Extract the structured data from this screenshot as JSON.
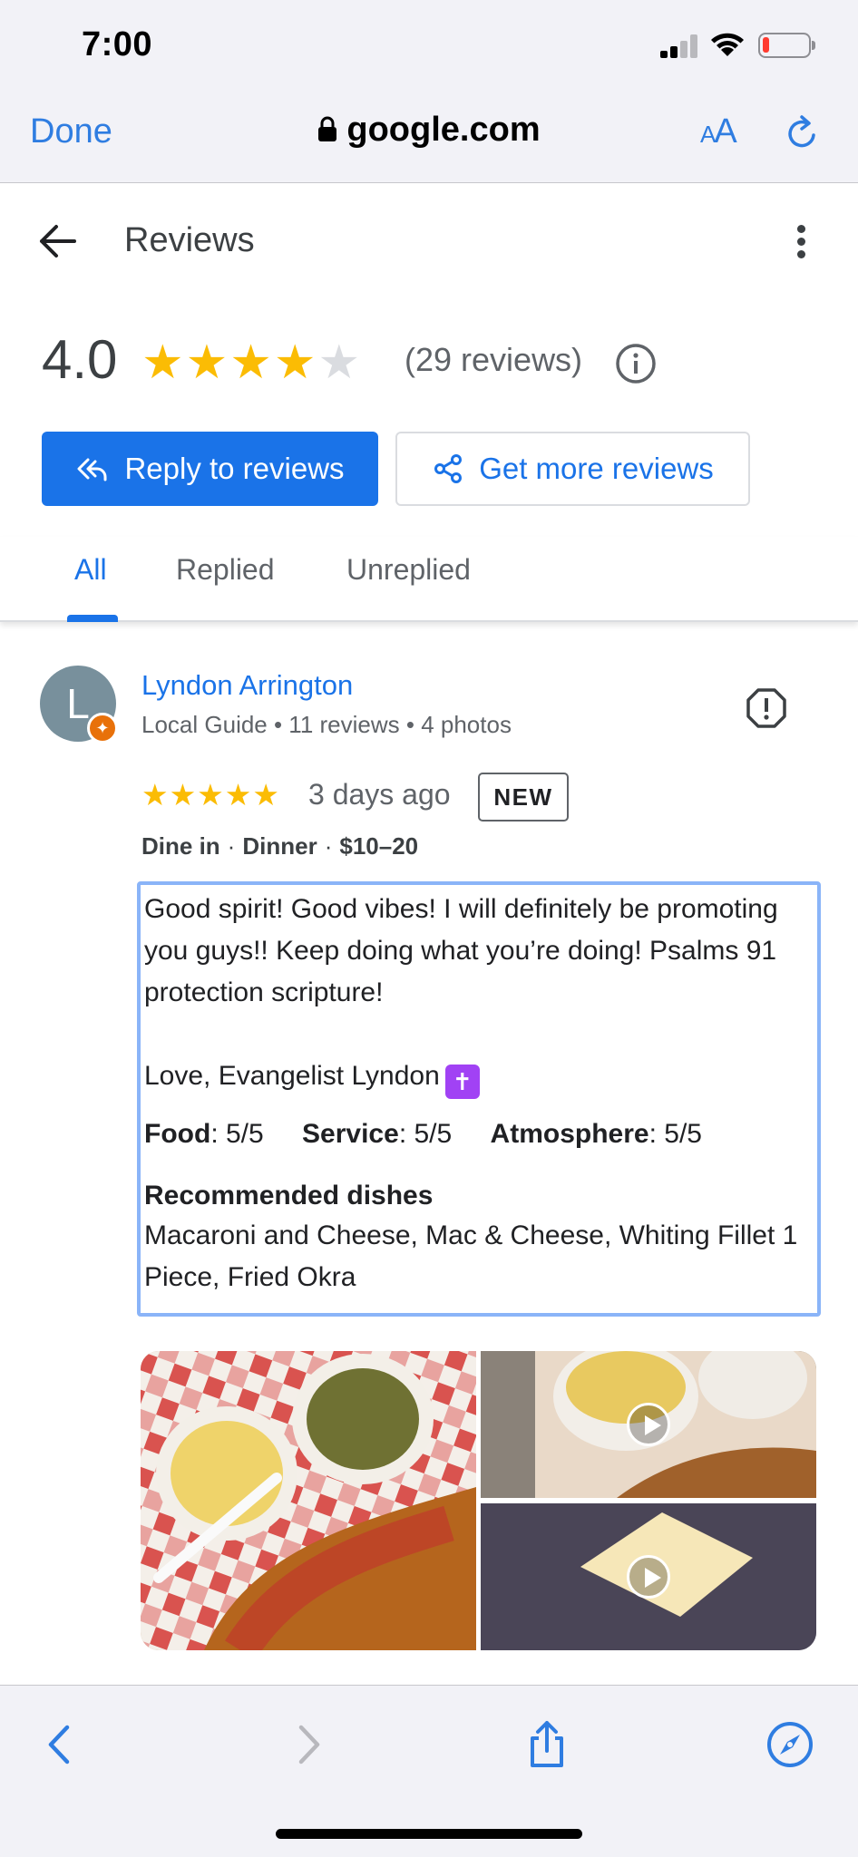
{
  "status_bar": {
    "time": "7:00"
  },
  "browser": {
    "done_label": "Done",
    "url": "google.com",
    "text_size_label": "A",
    "text_size_label_large": "A"
  },
  "header": {
    "title": "Reviews"
  },
  "summary": {
    "rating": "4.0",
    "rating_value": 4.0,
    "stars_max": 5,
    "review_count": "(29 reviews)"
  },
  "actions": {
    "reply_label": "Reply to reviews",
    "get_more_label": "Get more reviews"
  },
  "tabs": [
    {
      "label": "All",
      "active": true
    },
    {
      "label": "Replied",
      "active": false
    },
    {
      "label": "Unreplied",
      "active": false
    }
  ],
  "review": {
    "avatar_letter": "L",
    "author": "Lyndon Arrington",
    "meta": "Local Guide • 11 reviews • 4 photos",
    "stars": "★★★★★",
    "rating": 5,
    "time_ago": "3 days ago",
    "badge": "NEW",
    "visit": [
      "Dine in",
      "Dinner",
      "$10–20"
    ],
    "text": "Good spirit! Good vibes! I will definitely be promoting you guys!! Keep doing what you’re doing! Psalms 91 protection scripture!\n\nLove, Evangelist Lyndon",
    "emoji": "✝",
    "ratings": [
      {
        "label": "Food",
        "value": "5/5"
      },
      {
        "label": "Service",
        "value": "5/5"
      },
      {
        "label": "Atmosphere",
        "value": "5/5"
      }
    ],
    "dishes_title": "Recommended dishes",
    "dishes": "Macaroni and Cheese, Mac & Cheese, Whiting Fillet 1 Piece, Fried Okra"
  },
  "colors": {
    "accent": "#1a73e8",
    "star": "#fbbc04",
    "star_empty": "#dadce0",
    "ios_blue": "#2f7de1",
    "badge_orange": "#e8710a"
  },
  "icons": {
    "back": "back-arrow-icon",
    "more": "more-vert-icon",
    "info": "info-icon",
    "reply": "reply-all-icon",
    "share": "share-icon",
    "flag": "report-icon",
    "lock": "lock-icon",
    "reload": "reload-icon"
  }
}
